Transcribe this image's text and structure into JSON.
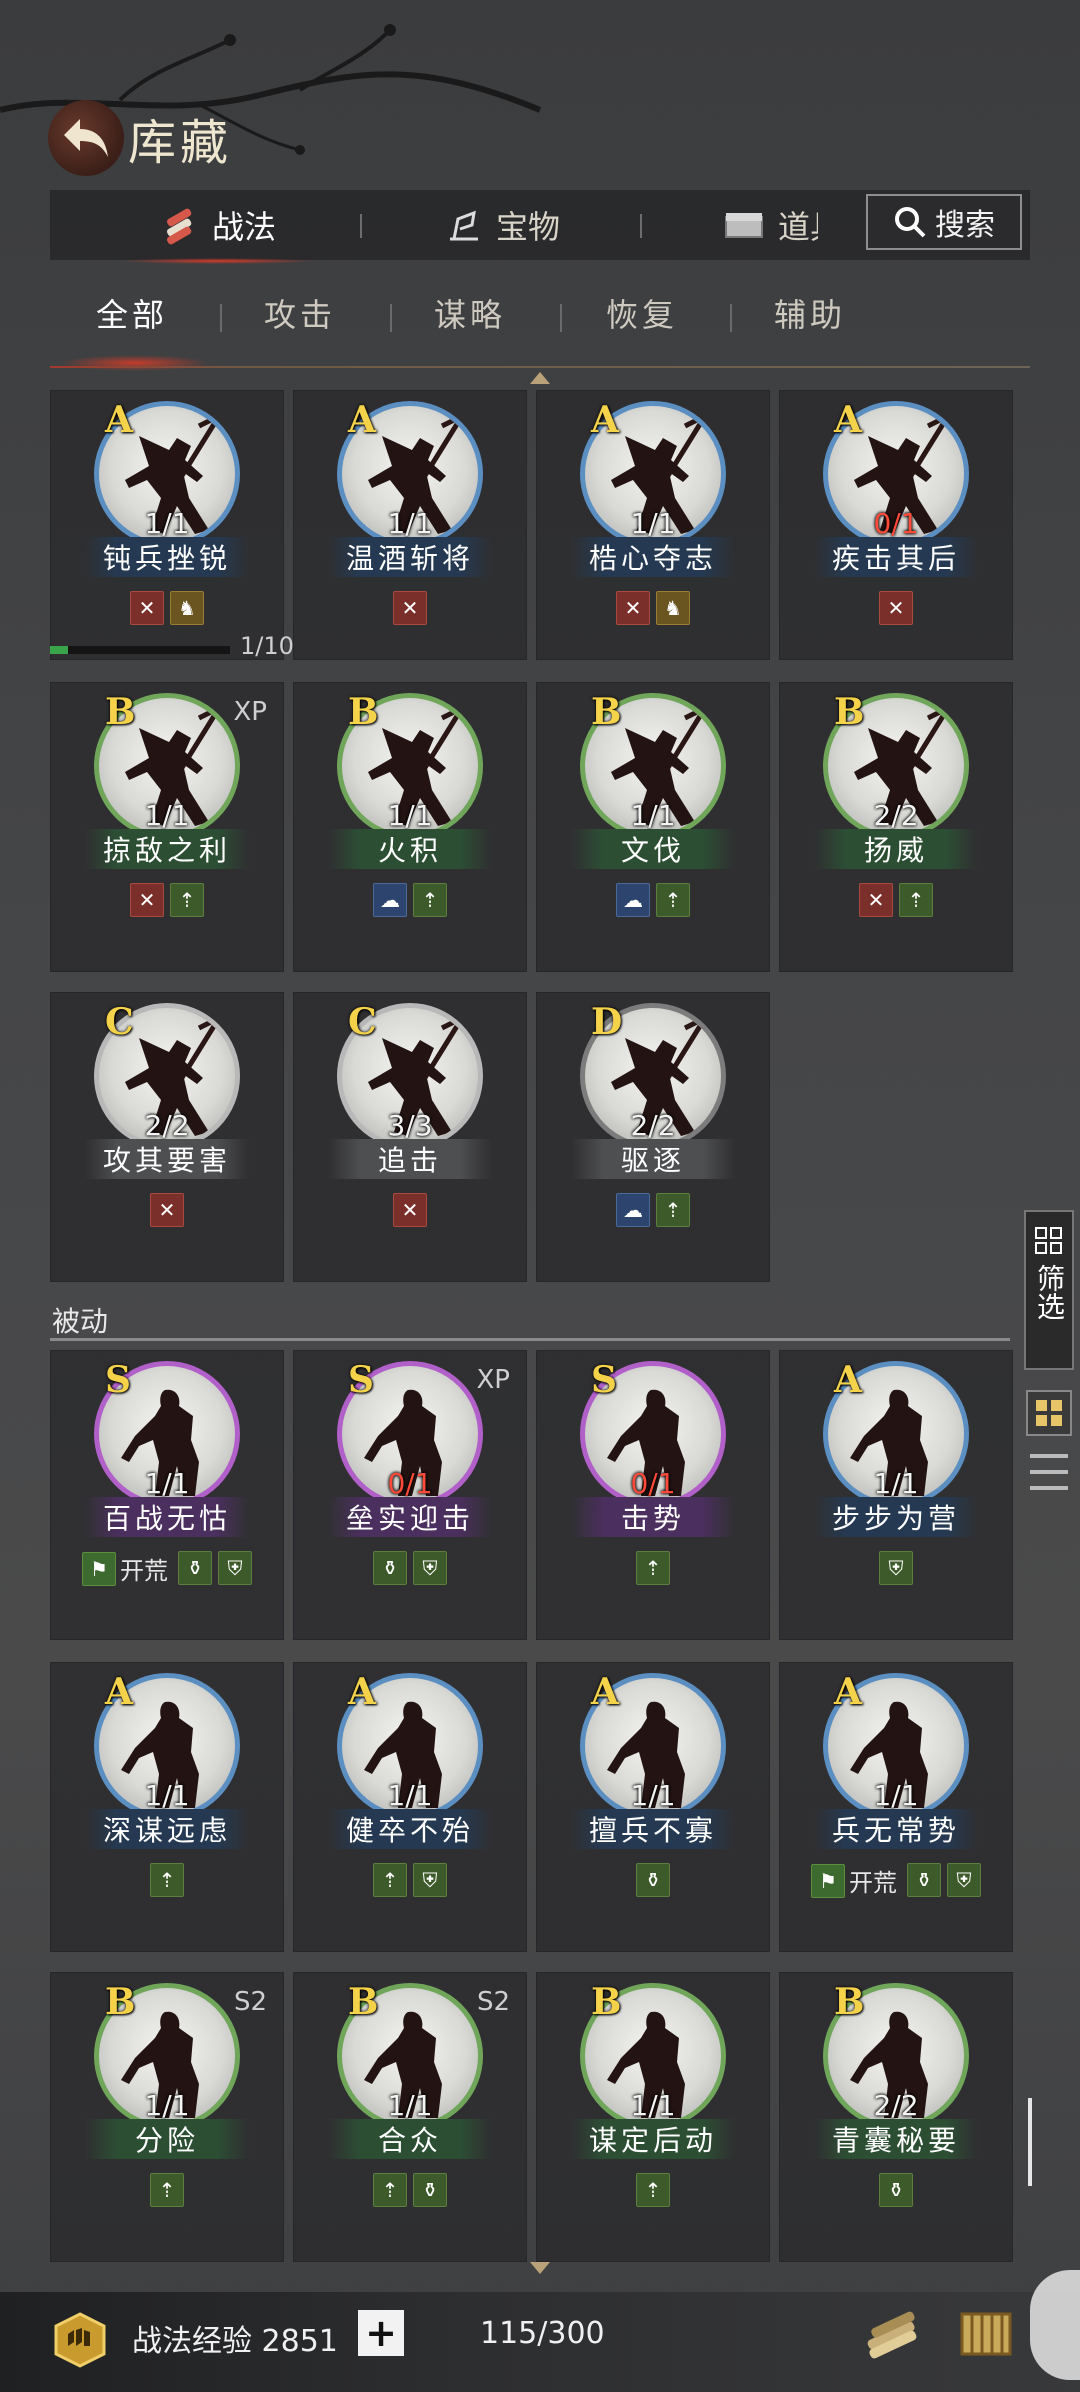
{
  "header": {
    "title": "库藏"
  },
  "main_tabs": [
    {
      "label": "战法",
      "icon": "scroll-bundle-icon",
      "active": true
    },
    {
      "label": "宝物",
      "icon": "treasure-icon",
      "active": false
    },
    {
      "label": "道具",
      "icon": "chest-icon",
      "active": false
    }
  ],
  "search": {
    "label": "搜索"
  },
  "sub_tabs": [
    {
      "label": "全部",
      "active": true
    },
    {
      "label": "攻击",
      "active": false
    },
    {
      "label": "谋略",
      "active": false
    },
    {
      "label": "恢复",
      "active": false
    },
    {
      "label": "辅助",
      "active": false
    }
  ],
  "active_cards": [
    {
      "grade": "A",
      "count": "1/1",
      "count_red": false,
      "name": "钝兵挫锐",
      "plate": "blue",
      "ring": "#5b8fc2",
      "tag": "",
      "icons": [
        "attack",
        "horse"
      ]
    },
    {
      "grade": "A",
      "count": "1/1",
      "count_red": false,
      "name": "温酒斩将",
      "plate": "blue",
      "ring": "#5b8fc2",
      "tag": "",
      "icons": [
        "attack"
      ]
    },
    {
      "grade": "A",
      "count": "1/1",
      "count_red": false,
      "name": "梏心夺志",
      "plate": "blue",
      "ring": "#5b8fc2",
      "tag": "",
      "icons": [
        "attack",
        "horse"
      ]
    },
    {
      "grade": "A",
      "count": "0/1",
      "count_red": true,
      "name": "疾击其后",
      "plate": "blue",
      "ring": "#5b8fc2",
      "tag": "",
      "icons": [
        "attack"
      ]
    },
    {
      "grade": "B",
      "count": "1/1",
      "count_red": false,
      "name": "掠敌之利",
      "plate": "green",
      "ring": "#6fa65a",
      "tag": "XP",
      "icons": [
        "attack",
        "ally"
      ]
    },
    {
      "grade": "B",
      "count": "1/1",
      "count_red": false,
      "name": "火积",
      "plate": "green",
      "ring": "#6fa65a",
      "tag": "",
      "icons": [
        "mind",
        "ally"
      ]
    },
    {
      "grade": "B",
      "count": "1/1",
      "count_red": false,
      "name": "文伐",
      "plate": "green",
      "ring": "#6fa65a",
      "tag": "",
      "icons": [
        "mind",
        "ally"
      ]
    },
    {
      "grade": "B",
      "count": "2/2",
      "count_red": false,
      "name": "扬威",
      "plate": "green",
      "ring": "#6fa65a",
      "tag": "",
      "icons": [
        "attack",
        "ally"
      ]
    },
    {
      "grade": "C",
      "count": "2/2",
      "count_red": false,
      "name": "攻其要害",
      "plate": "gray",
      "ring": "#b8b8b8",
      "tag": "",
      "icons": [
        "attack"
      ]
    },
    {
      "grade": "C",
      "count": "3/3",
      "count_red": false,
      "name": "追击",
      "plate": "gray",
      "ring": "#b8b8b8",
      "tag": "",
      "icons": [
        "attack"
      ]
    },
    {
      "grade": "D",
      "count": "2/2",
      "count_red": false,
      "name": "驱逐",
      "plate": "gray",
      "ring": "#7c7c7c",
      "tag": "",
      "icons": [
        "mind",
        "ally"
      ]
    }
  ],
  "first_card_progress": {
    "text": "1/10",
    "fraction": 0.1
  },
  "passive_section": {
    "label": "被动"
  },
  "passive_cards": [
    {
      "grade": "S",
      "count": "1/1",
      "count_red": false,
      "name": "百战无怙",
      "plate": "purple",
      "ring": "#b15fc9",
      "tag": "",
      "kaihuang": true,
      "icons": [
        "pot",
        "shield"
      ]
    },
    {
      "grade": "S",
      "count": "0/1",
      "count_red": true,
      "name": "垒实迎击",
      "plate": "purple",
      "ring": "#b15fc9",
      "tag": "XP",
      "kaihuang": false,
      "icons": [
        "pot",
        "shield"
      ]
    },
    {
      "grade": "S",
      "count": "0/1",
      "count_red": true,
      "name": "击势",
      "plate": "purple",
      "ring": "#b15fc9",
      "tag": "",
      "kaihuang": false,
      "icons": [
        "ally"
      ]
    },
    {
      "grade": "A",
      "count": "1/1",
      "count_red": false,
      "name": "步步为营",
      "plate": "blue",
      "ring": "#5b8fc2",
      "tag": "",
      "kaihuang": false,
      "icons": [
        "shield"
      ]
    },
    {
      "grade": "A",
      "count": "1/1",
      "count_red": false,
      "name": "深谋远虑",
      "plate": "blue",
      "ring": "#5b8fc2",
      "tag": "",
      "kaihuang": false,
      "icons": [
        "ally"
      ]
    },
    {
      "grade": "A",
      "count": "1/1",
      "count_red": false,
      "name": "健卒不殆",
      "plate": "blue",
      "ring": "#5b8fc2",
      "tag": "",
      "kaihuang": false,
      "icons": [
        "ally",
        "shield"
      ]
    },
    {
      "grade": "A",
      "count": "1/1",
      "count_red": false,
      "name": "擅兵不寡",
      "plate": "blue",
      "ring": "#5b8fc2",
      "tag": "",
      "kaihuang": false,
      "icons": [
        "pot"
      ]
    },
    {
      "grade": "A",
      "count": "1/1",
      "count_red": false,
      "name": "兵无常势",
      "plate": "blue",
      "ring": "#5b8fc2",
      "tag": "",
      "kaihuang": true,
      "icons": [
        "pot",
        "shield"
      ]
    },
    {
      "grade": "B",
      "count": "1/1",
      "count_red": false,
      "name": "分险",
      "plate": "green",
      "ring": "#6fa65a",
      "tag": "S2",
      "kaihuang": false,
      "icons": [
        "ally"
      ]
    },
    {
      "grade": "B",
      "count": "1/1",
      "count_red": false,
      "name": "合众",
      "plate": "green",
      "ring": "#6fa65a",
      "tag": "S2",
      "kaihuang": false,
      "icons": [
        "ally",
        "pot"
      ]
    },
    {
      "grade": "B",
      "count": "1/1",
      "count_red": false,
      "name": "谋定后动",
      "plate": "green",
      "ring": "#6fa65a",
      "tag": "",
      "kaihuang": false,
      "icons": [
        "ally"
      ]
    },
    {
      "grade": "B",
      "count": "2/2",
      "count_red": false,
      "name": "青囊秘要",
      "plate": "green",
      "ring": "#6fa65a",
      "tag": "",
      "kaihuang": false,
      "icons": [
        "pot"
      ]
    }
  ],
  "kaihuang_label": "开荒",
  "side": {
    "filter_label": "筛选"
  },
  "bottom": {
    "exp_label": "战法经验 2851",
    "plus": "+",
    "capacity": "115/300"
  }
}
